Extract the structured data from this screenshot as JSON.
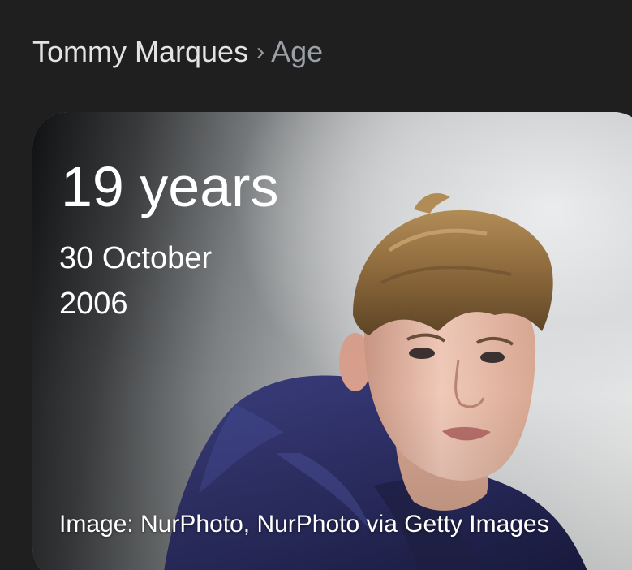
{
  "breadcrumb": {
    "entity": "Tommy Marques",
    "separator": "›",
    "attribute": "Age"
  },
  "card": {
    "age_value": "19 years",
    "birth_date": "30 October 2006",
    "image_credit": "Image: NurPhoto, NurPhoto via Getty Images"
  },
  "colors": {
    "background": "#1f1f1f",
    "breadcrumb_entity": "#e3e3e3",
    "breadcrumb_muted": "#9aa0a6",
    "card_text": "#ffffff",
    "jacket": "#2d2f63"
  }
}
